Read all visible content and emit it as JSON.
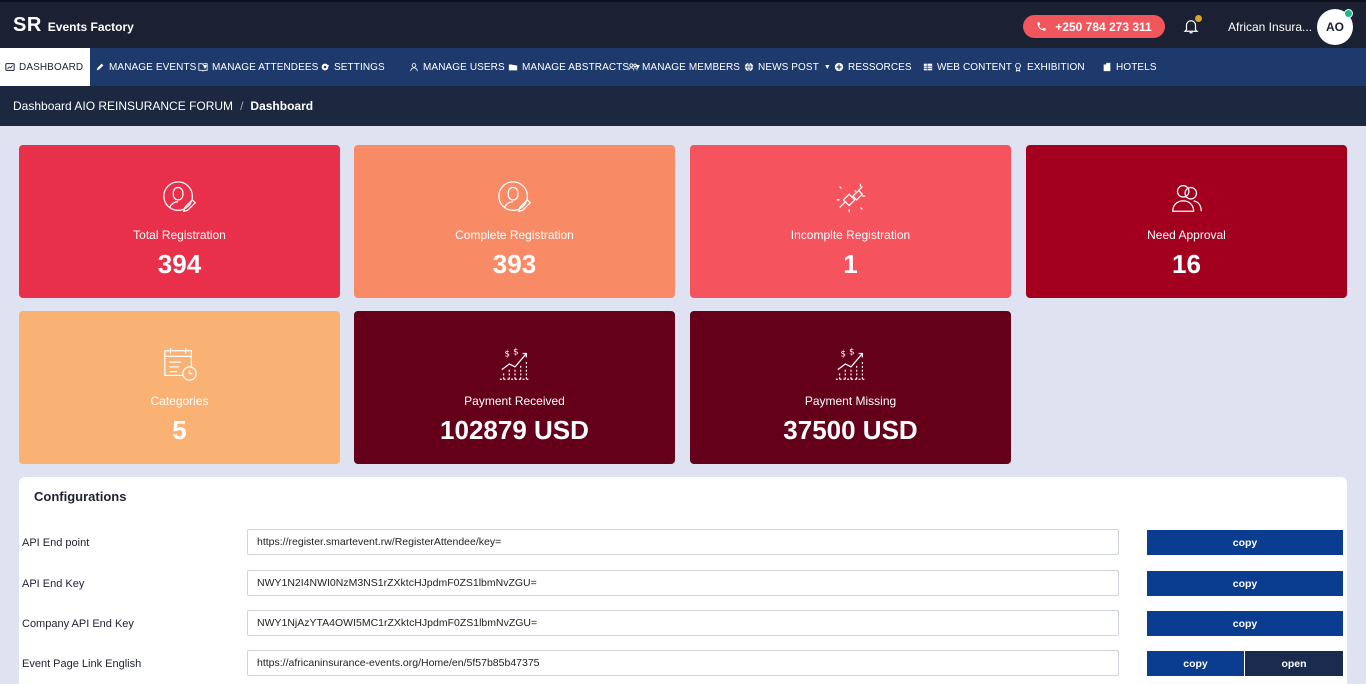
{
  "header": {
    "logo_short": "SR",
    "logo_name": "Events Factory",
    "phone": "+250 784 273 311",
    "org_name": "African Insura...",
    "avatar_initials": "AO"
  },
  "nav": {
    "items": [
      {
        "label": "DASHBOARD"
      },
      {
        "label": "MANAGE EVENTS"
      },
      {
        "label": "MANAGE ATTENDEES"
      },
      {
        "label": "SETTINGS"
      },
      {
        "label": "MANAGE USERS"
      },
      {
        "label": "MANAGE ABSTRACTS"
      },
      {
        "label": "MANAGE MEMBERS"
      },
      {
        "label": "NEWS POST"
      },
      {
        "label": "RESSORCES"
      },
      {
        "label": "WEB CONTENT"
      },
      {
        "label": "EXHIBITION"
      },
      {
        "label": "HOTELS"
      }
    ]
  },
  "breadcrumb": {
    "parent": "Dashboard AIO REINSURANCE FORUM",
    "separator": "/",
    "current": "Dashboard"
  },
  "cards": [
    {
      "label": "Total Registration",
      "value": "394",
      "color": "#e8304a",
      "icon": "user-edit-icon"
    },
    {
      "label": "Complete Registration",
      "value": "393",
      "color": "#f98a66",
      "icon": "user-edit-icon"
    },
    {
      "label": "Incomplte Registration",
      "value": "1",
      "color": "#f5535e",
      "icon": "unplugged-icon"
    },
    {
      "label": "Need Approval",
      "value": "16",
      "color": "#a3001f",
      "icon": "users-icon"
    },
    {
      "label": "Categories",
      "value": "5",
      "color": "#f9b274",
      "icon": "calendar-clock-icon"
    },
    {
      "label": "Payment Received",
      "value": "102879 USD",
      "color": "#65001a",
      "icon": "money-growth-icon"
    },
    {
      "label": "Payment Missing",
      "value": "37500 USD",
      "color": "#65001a",
      "icon": "money-growth-icon"
    }
  ],
  "config": {
    "title": "Configurations",
    "rows": [
      {
        "label": "API End point",
        "value": "https://register.smartevent.rw/RegisterAttendee/key=",
        "button": "copy"
      },
      {
        "label": "API End Key",
        "value": "NWY1N2I4NWI0NzM3NS1rZXktcHJpdmF0ZS1lbmNvZGU=",
        "button": "copy"
      },
      {
        "label": "Company API End Key",
        "value": "NWY1NjAzYTA4OWI5MC1rZXktcHJpdmF0ZS1lbmNvZGU=",
        "button": "copy"
      },
      {
        "label": "Event Page Link English",
        "value": "https://africaninsurance-events.org/Home/en/5f57b85b47375",
        "button": "copy",
        "button2": "open"
      }
    ]
  }
}
